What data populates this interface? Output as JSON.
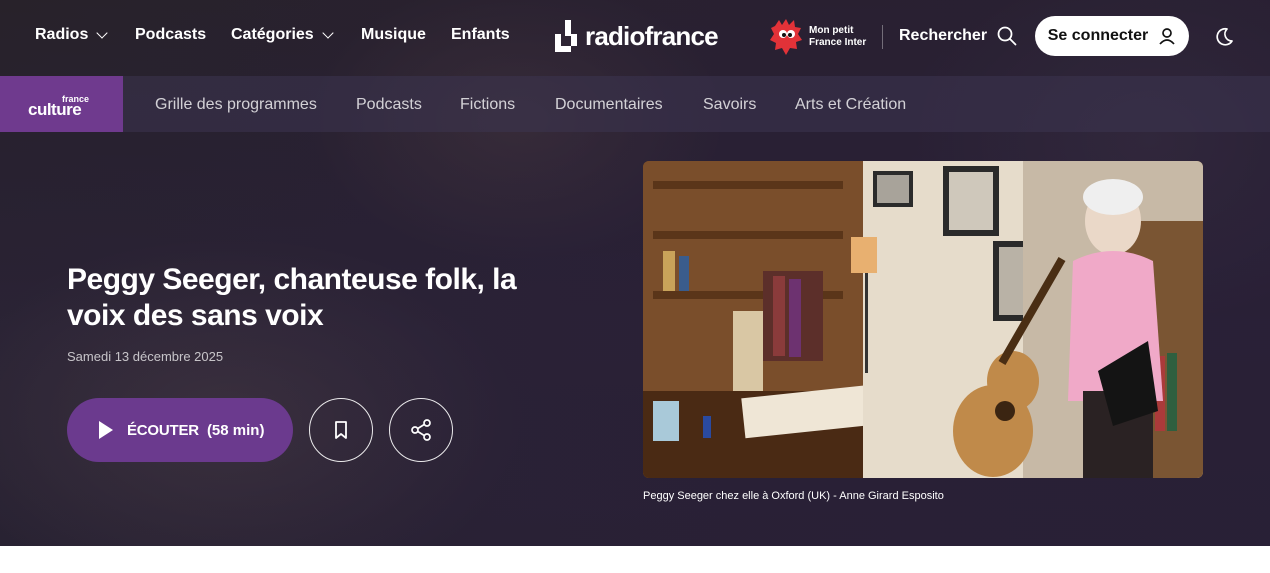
{
  "header": {
    "nav": [
      {
        "label": "Radios",
        "dropdown": true
      },
      {
        "label": "Podcasts",
        "dropdown": false
      },
      {
        "label": "Catégories",
        "dropdown": true
      },
      {
        "label": "Musique",
        "dropdown": false
      },
      {
        "label": "Enfants",
        "dropdown": false
      }
    ],
    "logo_text": "radiofrance",
    "mon_petit_line1": "Mon petit",
    "mon_petit_line2": "France Inter",
    "search_label": "Rechercher",
    "connect_label": "Se connecter"
  },
  "subnav": {
    "station_small": "france",
    "station_big": "culture",
    "items": [
      "Grille des programmes",
      "Podcasts",
      "Fictions",
      "Documentaires",
      "Savoirs",
      "Arts et Création"
    ]
  },
  "episode": {
    "title": "Peggy Seeger, chanteuse folk, la voix des sans voix",
    "date": "Samedi 13 décembre 2025",
    "listen_label": "ÉCOUTER",
    "duration": "(58 min)",
    "image_caption": "Peggy Seeger chez elle à Oxford (UK) - Anne Girard Esposito"
  },
  "colors": {
    "accent_purple": "#6b3a8e",
    "station_purple": "#6f3a8e",
    "mascot_red": "#e23238"
  }
}
